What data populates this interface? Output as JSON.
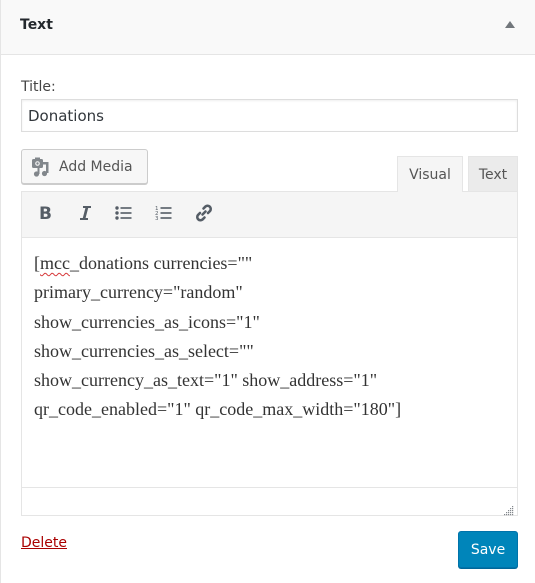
{
  "widget": {
    "title": "Text",
    "toggle_icon": "triangle-up-icon"
  },
  "form": {
    "title_label": "Title:",
    "title_value": "Donations",
    "add_media_label": "Add Media",
    "add_media_icon": "media-icon",
    "tabs": [
      {
        "label": "Visual",
        "active": true
      },
      {
        "label": "Text",
        "active": false
      }
    ],
    "toolbar": [
      {
        "name": "bold",
        "icon": "bold-icon"
      },
      {
        "name": "italic",
        "icon": "italic-icon"
      },
      {
        "name": "bulleted-list",
        "icon": "bulleted-list-icon"
      },
      {
        "name": "numbered-list",
        "icon": "numbered-list-icon"
      },
      {
        "name": "link",
        "icon": "link-icon"
      }
    ],
    "content_lines": [
      "[mcc_donations currencies=\"\"",
      "primary_currency=\"random\"",
      "show_currencies_as_icons=\"1\"",
      "show_currencies_as_select=\"\"",
      "show_currency_as_text=\"1\" show_address=\"1\"",
      "qr_code_enabled=\"1\" qr_code_max_width=\"180\"]"
    ],
    "content_first_word_prefix": "[",
    "content_misspelled_word": "mcc",
    "content_first_line_rest": "_donations currencies=\"\""
  },
  "actions": {
    "delete_label": "Delete",
    "save_label": "Save"
  },
  "colors": {
    "save_button": "#0085ba",
    "delete_link": "#aa0000",
    "spellcheck_underline": "#d63638"
  }
}
